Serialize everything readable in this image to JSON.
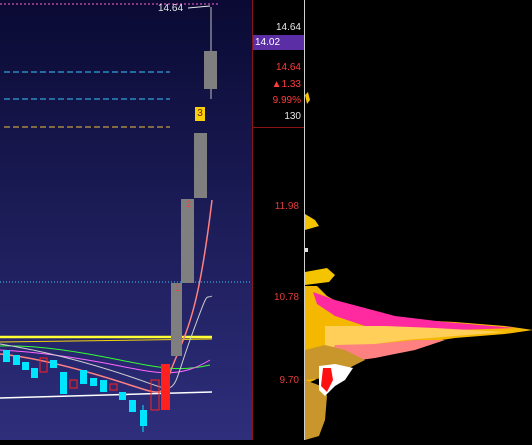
{
  "top_price_label": "14.64",
  "price_axis": {
    "high": "14.64",
    "current": "14.02",
    "info_price": "14.64",
    "info_change": "▲1.33",
    "info_pct": "9.99%",
    "info_volume": "130",
    "ticks": [
      "11.98",
      "10.78",
      "9.70"
    ]
  },
  "wave_labels": [
    "1",
    "2",
    "3"
  ],
  "colors": {
    "chart_bg_top": "#0c0c3c",
    "chart_bg_bottom": "#2c2c78",
    "up_candle": "#ff2020",
    "down_candle": "#00e5ff",
    "limit_up_candle": "#7f7f7f",
    "accent_purple": "#5b2ea6"
  }
}
